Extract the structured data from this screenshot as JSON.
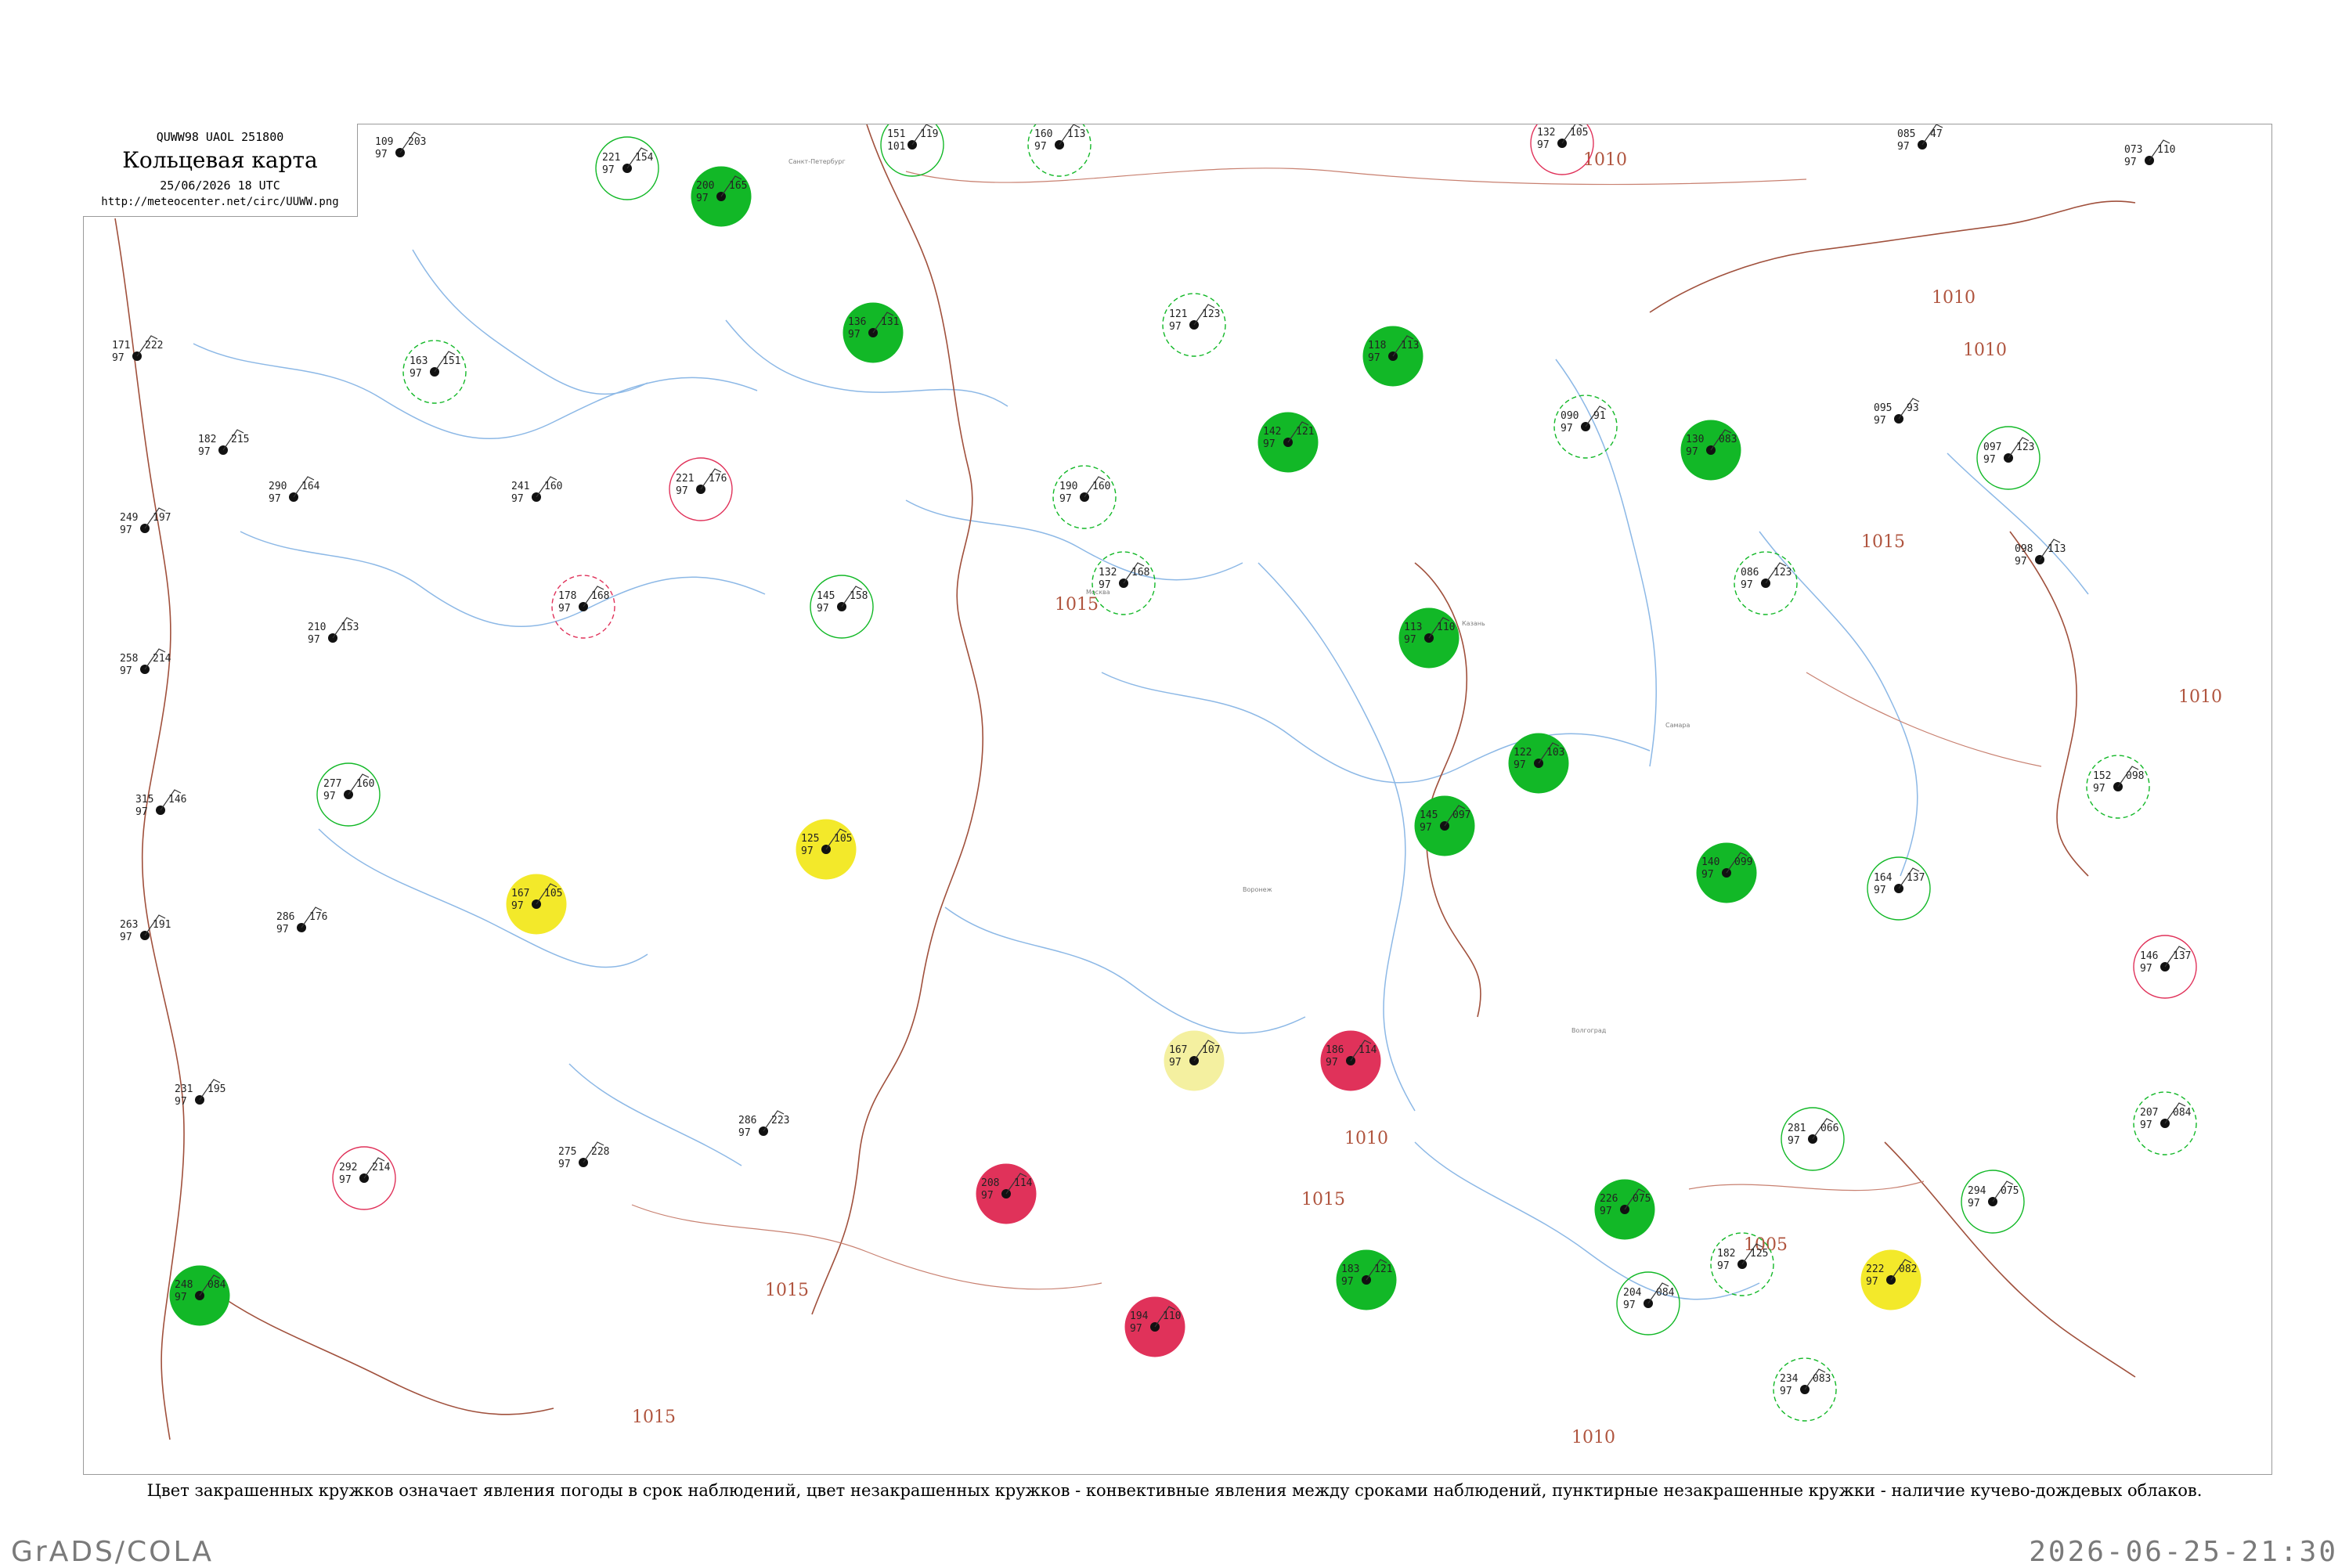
{
  "header": {
    "code": "QUWW98  UAOL  251800",
    "title": "Кольцевая карта",
    "datetime": "25/06/2026 18 UTC",
    "url": "http://meteocenter.net/circ/UUWW.png"
  },
  "caption": "Цвет закрашенных кружков означает явления погоды в срок наблюдений, цвет незакрашенных кружков - конвективные явления между сроками наблюдений, пунктирные незакрашенные кружки - наличие кучево-дождевых облаков.",
  "footer": {
    "software": "GrADS/COLA",
    "generated": "2026-06-25-21:30"
  },
  "colors": {
    "rain_fill": "#12b827",
    "thunder_fill": "#e0325a",
    "haze_fill": "#f3e92a",
    "light_fill": "#f4f0a0",
    "isobar": "#a0503c",
    "river": "#8cb8e6",
    "station_text": "#222222",
    "frame": "#9a9a9a"
  },
  "isobars": [
    {
      "label": "1010"
    },
    {
      "label": "1010"
    },
    {
      "label": "1010"
    },
    {
      "label": "1015"
    },
    {
      "label": "1015"
    },
    {
      "label": "1015"
    },
    {
      "label": "1010"
    },
    {
      "label": "1005"
    },
    {
      "label": "1010"
    },
    {
      "label": "1015"
    },
    {
      "label": "1010"
    },
    {
      "label": "1015"
    }
  ],
  "stations": [
    {
      "t": "109",
      "p": "203",
      "b": "97"
    },
    {
      "t": "221",
      "p": "154",
      "b": "97"
    },
    {
      "t": "200",
      "p": "165",
      "b": "97"
    },
    {
      "t": "151",
      "p": "119",
      "b": "101"
    },
    {
      "t": "160",
      "p": "113",
      "b": "97"
    },
    {
      "t": "132",
      "p": "105",
      "b": "97"
    },
    {
      "t": "085",
      "p": "47",
      "b": "97"
    },
    {
      "t": "073",
      "p": "110",
      "b": "97"
    },
    {
      "t": "171",
      "p": "222",
      "b": "97"
    },
    {
      "t": "182",
      "p": "215",
      "b": "97"
    },
    {
      "t": "163",
      "p": "151",
      "b": "97"
    },
    {
      "t": "136",
      "p": "131",
      "b": "97"
    },
    {
      "t": "121",
      "p": "123",
      "b": "97"
    },
    {
      "t": "118",
      "p": "113",
      "b": "97"
    },
    {
      "t": "090",
      "p": "91",
      "b": "97"
    },
    {
      "t": "095",
      "p": "93",
      "b": "97"
    },
    {
      "t": "249",
      "p": "197",
      "b": "97"
    },
    {
      "t": "290",
      "p": "164",
      "b": "97"
    },
    {
      "t": "241",
      "p": "160",
      "b": "97"
    },
    {
      "t": "221",
      "p": "176",
      "b": "97"
    },
    {
      "t": "190",
      "p": "160",
      "b": "97"
    },
    {
      "t": "142",
      "p": "121",
      "b": "97"
    },
    {
      "t": "130",
      "p": "083",
      "b": "97"
    },
    {
      "t": "097",
      "p": "123",
      "b": "97"
    },
    {
      "t": "258",
      "p": "214",
      "b": "97"
    },
    {
      "t": "210",
      "p": "153",
      "b": "97"
    },
    {
      "t": "178",
      "p": "168",
      "b": "97"
    },
    {
      "t": "145",
      "p": "158",
      "b": "97"
    },
    {
      "t": "132",
      "p": "168",
      "b": "97"
    },
    {
      "t": "113",
      "p": "110",
      "b": "97"
    },
    {
      "t": "086",
      "p": "123",
      "b": "97"
    },
    {
      "t": "098",
      "p": "113",
      "b": "97"
    },
    {
      "t": "315",
      "p": "146",
      "b": "97"
    },
    {
      "t": "277",
      "p": "160",
      "b": "97"
    },
    {
      "t": "145",
      "p": "097",
      "b": "97"
    },
    {
      "t": "122",
      "p": "103",
      "b": "97"
    },
    {
      "t": "140",
      "p": "099",
      "b": "97"
    },
    {
      "t": "164",
      "p": "137",
      "b": "97"
    },
    {
      "t": "152",
      "p": "098",
      "b": "97"
    },
    {
      "t": "146",
      "p": "137",
      "b": "97"
    },
    {
      "t": "263",
      "p": "191",
      "b": "97"
    },
    {
      "t": "286",
      "p": "176",
      "b": "97"
    },
    {
      "t": "167",
      "p": "105",
      "b": "97"
    },
    {
      "t": "125",
      "p": "105",
      "b": "97"
    },
    {
      "t": "167",
      "p": "107",
      "b": "97"
    },
    {
      "t": "294",
      "p": "075",
      "b": "97"
    },
    {
      "t": "207",
      "p": "084",
      "b": "97"
    },
    {
      "t": "281",
      "p": "066",
      "b": "97"
    },
    {
      "t": "231",
      "p": "195",
      "b": "97"
    },
    {
      "t": "292",
      "p": "214",
      "b": "97"
    },
    {
      "t": "186",
      "p": "114",
      "b": "97"
    },
    {
      "t": "208",
      "p": "114",
      "b": "97"
    },
    {
      "t": "222",
      "p": "082",
      "b": "97"
    },
    {
      "t": "226",
      "p": "075",
      "b": "97"
    },
    {
      "t": "275",
      "p": "228",
      "b": "97"
    },
    {
      "t": "286",
      "p": "223",
      "b": "97"
    },
    {
      "t": "248",
      "p": "084",
      "b": "97"
    },
    {
      "t": "183",
      "p": "121",
      "b": "97"
    },
    {
      "t": "182",
      "p": "125",
      "b": "97"
    },
    {
      "t": "194",
      "p": "110",
      "b": "97"
    },
    {
      "t": "234",
      "p": "083",
      "b": "97"
    },
    {
      "t": "204",
      "p": "084",
      "b": "97"
    }
  ],
  "named_places": [
    {
      "name": "Москва"
    },
    {
      "name": "Санкт-Петербург"
    },
    {
      "name": "Казань"
    },
    {
      "name": "Самара"
    },
    {
      "name": "Волгоград"
    },
    {
      "name": "Воронеж"
    }
  ]
}
